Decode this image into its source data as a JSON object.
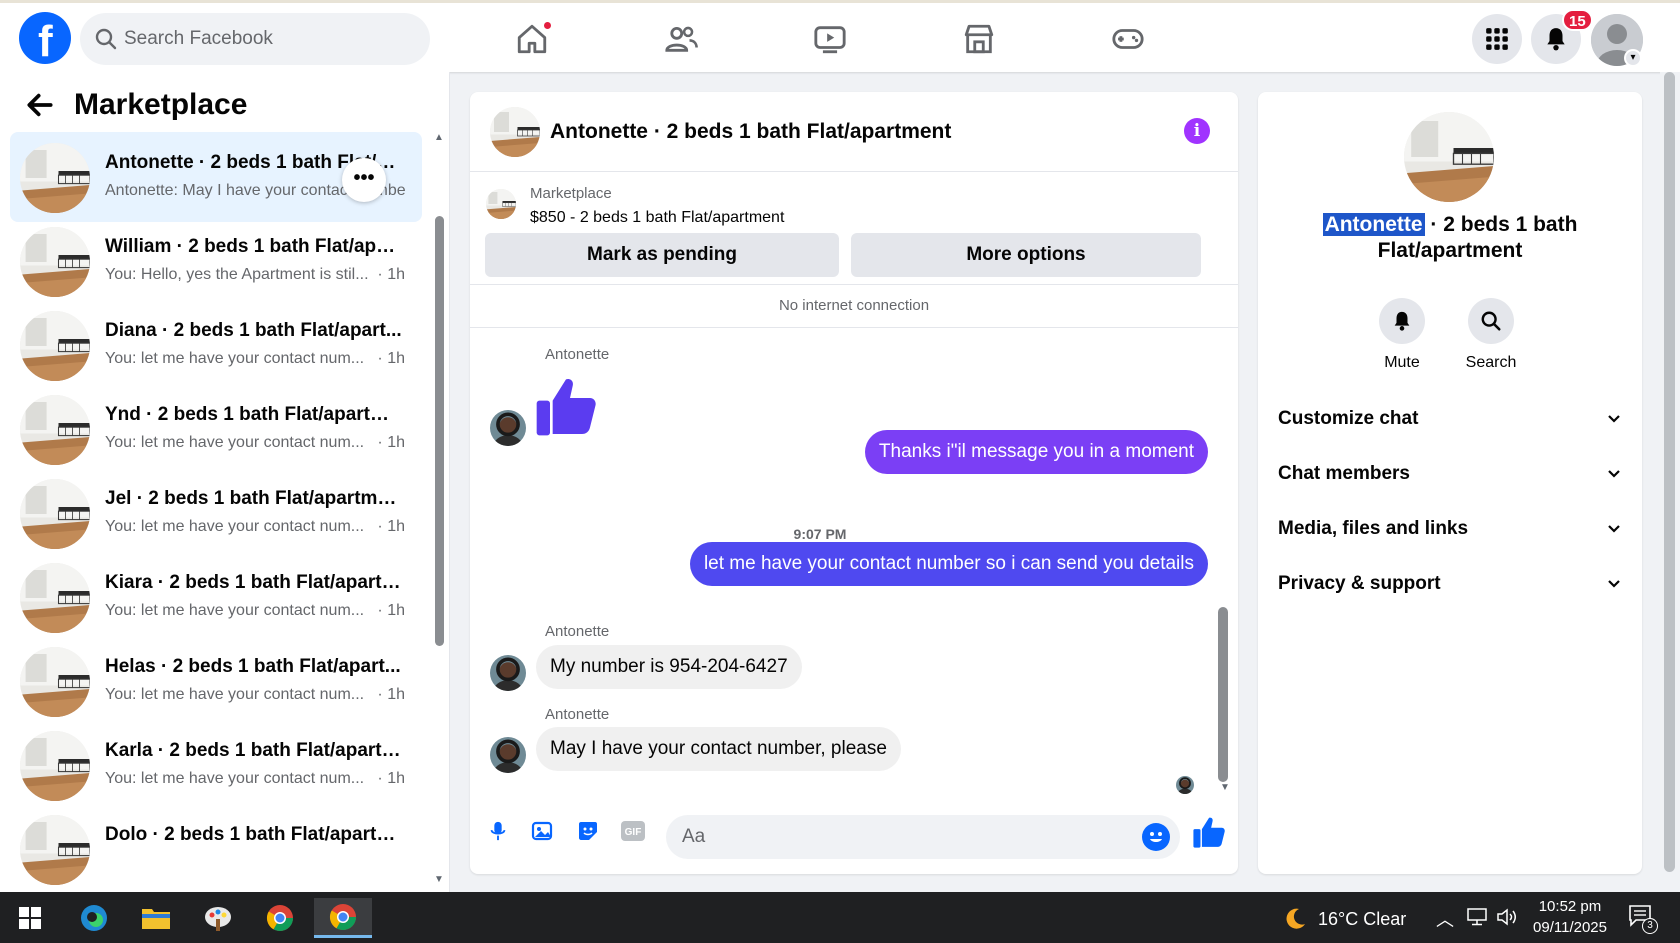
{
  "topbar": {
    "search_placeholder": "Search Facebook",
    "notification_count": "15"
  },
  "left": {
    "title": "Marketplace",
    "conversations": [
      {
        "name": "Antonette · 2 beds 1 bath Flat/apartment",
        "snippet": "Antonette: May I have your contact number, please",
        "time": "· 1h"
      },
      {
        "name": "William · 2 beds 1 bath Flat/apar...",
        "snippet": "You: Hello, yes the Apartment is stil...",
        "time": "· 1h"
      },
      {
        "name": "Diana · 2 beds 1 bath Flat/apart...",
        "snippet": "You: let me have your contact num...",
        "time": "· 1h"
      },
      {
        "name": "Ynd · 2 beds 1 bath Flat/apartme...",
        "snippet": "You: let me have your contact num...",
        "time": "· 1h"
      },
      {
        "name": "Jel · 2 beds 1 bath Flat/apartment",
        "snippet": "You: let me have your contact num...",
        "time": "· 1h"
      },
      {
        "name": "Kiara · 2 beds 1 bath Flat/apartm...",
        "snippet": "You: let me have your contact num...",
        "time": "· 1h"
      },
      {
        "name": "Helas · 2 beds 1 bath Flat/apart...",
        "snippet": "You: let me have your contact num...",
        "time": "· 1h"
      },
      {
        "name": "Karla · 2 beds 1 bath Flat/apartm...",
        "snippet": "You: let me have your contact num...",
        "time": "· 1h"
      },
      {
        "name": "Dolo · 2 beds 1 bath Flat/apartm...",
        "snippet": "",
        "time": ""
      }
    ],
    "more_label": "•••"
  },
  "chat": {
    "title": "Antonette · 2 beds 1 bath Flat/apartment",
    "marketplace_label": "Marketplace",
    "listing": "$850 - 2 beds 1 bath Flat/apartment",
    "mark_pending": "Mark as pending",
    "more_options": "More options",
    "offline_notice": "No internet connection",
    "sender_name": "Antonette",
    "out_msg_1": "Thanks i\"il message you in a moment",
    "timestamp": "9:07 PM",
    "out_msg_2": "let me have your contact number so i can send you details",
    "in_msg_1": "My number is 954-204-6427",
    "in_msg_2": "May I have your contact number, please",
    "composer_placeholder": "Aa"
  },
  "right": {
    "title_highlight": "Antonette",
    "title_rest": " · 2 beds 1 bath Flat/apartment",
    "mute": "Mute",
    "search": "Search",
    "sections": [
      "Customize chat",
      "Chat members",
      "Media, files and links",
      "Privacy & support"
    ]
  },
  "taskbar": {
    "weather": "16°C  Clear",
    "time": "10:52 pm",
    "date": "09/11/2025",
    "notif_count": "3"
  },
  "colors": {
    "brand": "#0866ff",
    "outgoing_bubble": "#7b3ff5",
    "outgoing_bubble_2": "#4f49f0",
    "like_purple": "#5b3cf0",
    "info": "#a033ff",
    "badge": "#e41e3f"
  },
  "icons": [
    "facebook-logo-icon",
    "search-icon",
    "home-icon",
    "friends-icon",
    "video-icon",
    "marketplace-icon",
    "gaming-icon",
    "menu-grid-icon",
    "bell-icon",
    "back-arrow-icon",
    "info-icon",
    "thumbs-up-icon",
    "mic-icon",
    "image-icon",
    "sticker-icon",
    "gif-icon",
    "emoji-icon",
    "chevron-down-icon",
    "windows-icon",
    "edge-icon",
    "folder-icon",
    "chrome-icon",
    "moon-icon"
  ]
}
